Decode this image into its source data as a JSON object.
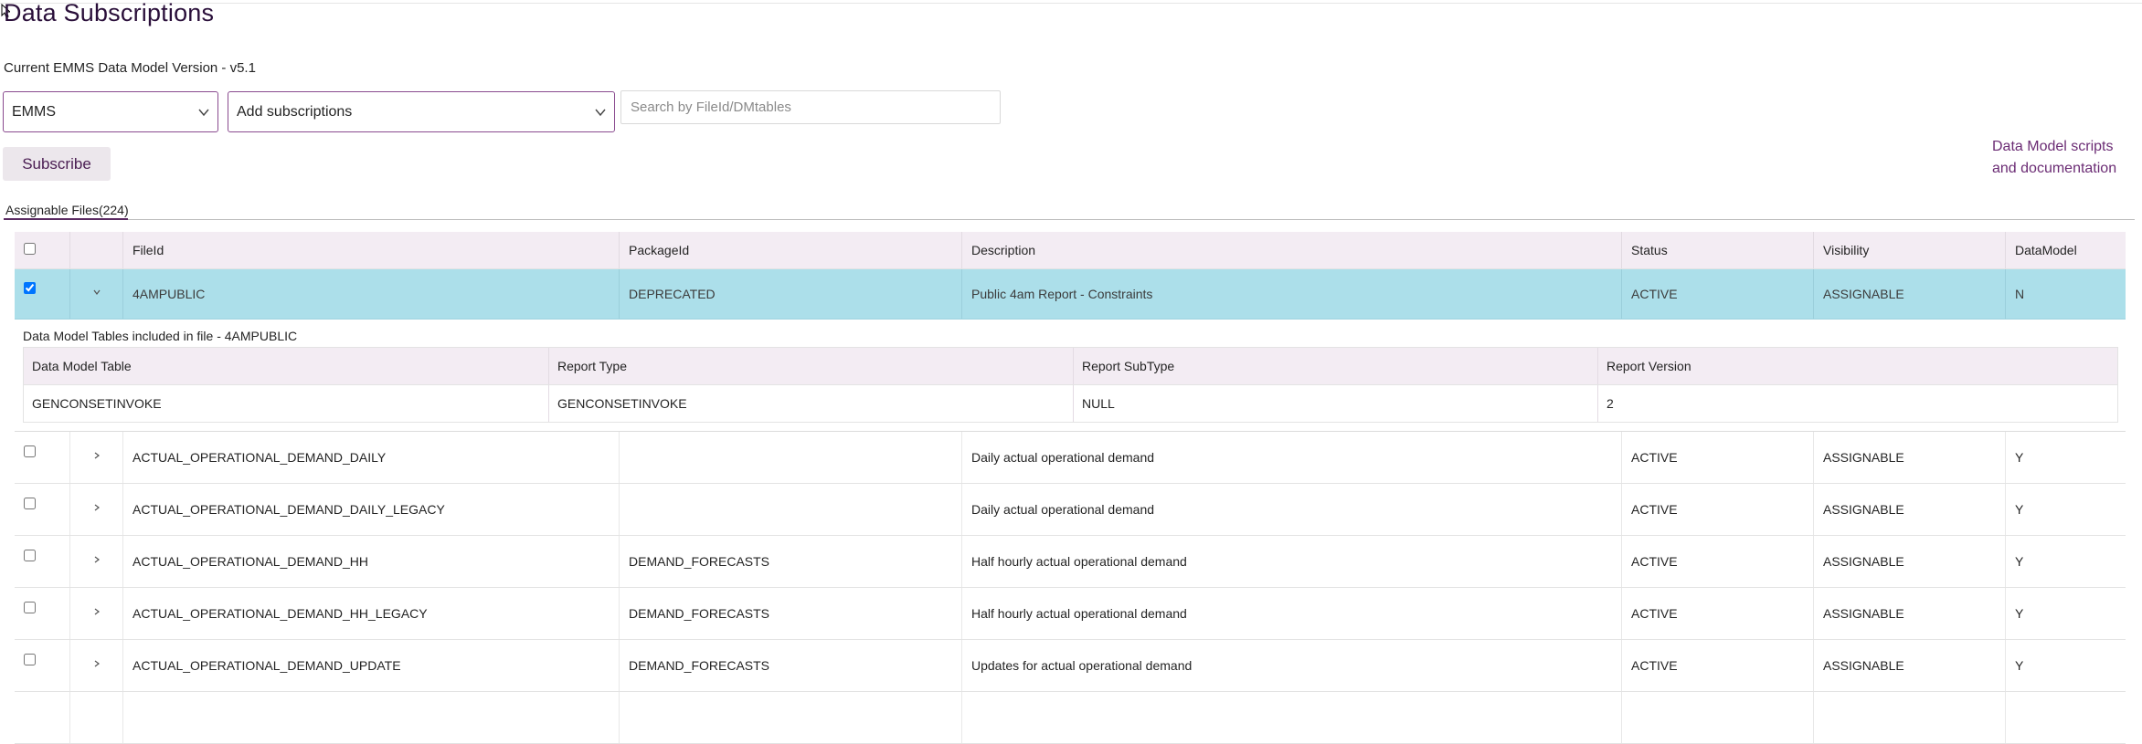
{
  "page": {
    "title": "Data Subscriptions",
    "model_version": "Current EMMS Data Model Version - v5.1"
  },
  "controls": {
    "system_select": {
      "value": "EMMS",
      "icon": "chevron-down-icon"
    },
    "subscription_select": {
      "value": "Add subscriptions",
      "icon": "chevron-down-icon"
    },
    "search": {
      "placeholder": "Search by FileId/DMtables"
    },
    "subscribe_label": "Subscribe",
    "doc_link_line1": "Data Model scripts",
    "doc_link_line2": "and documentation"
  },
  "tab": {
    "label": "Assignable Files(224)"
  },
  "columns": {
    "fileid": "FileId",
    "packageid": "PackageId",
    "description": "Description",
    "status": "Status",
    "visibility": "Visibility",
    "datamodel": "DataModel"
  },
  "rows": [
    {
      "fileid": "4AMPUBLIC",
      "packageid": "DEPRECATED",
      "description": "Public 4am Report - Constraints",
      "status": "ACTIVE",
      "visibility": "ASSIGNABLE",
      "datamodel": "N"
    },
    {
      "fileid": "ACTUAL_OPERATIONAL_DEMAND_DAILY",
      "packageid": "",
      "description": "Daily actual operational demand",
      "status": "ACTIVE",
      "visibility": "ASSIGNABLE",
      "datamodel": "Y"
    },
    {
      "fileid": "ACTUAL_OPERATIONAL_DEMAND_DAILY_LEGACY",
      "packageid": "",
      "description": "Daily actual operational demand",
      "status": "ACTIVE",
      "visibility": "ASSIGNABLE",
      "datamodel": "Y"
    },
    {
      "fileid": "ACTUAL_OPERATIONAL_DEMAND_HH",
      "packageid": "DEMAND_FORECASTS",
      "description": "Half hourly actual operational demand",
      "status": "ACTIVE",
      "visibility": "ASSIGNABLE",
      "datamodel": "Y"
    },
    {
      "fileid": "ACTUAL_OPERATIONAL_DEMAND_HH_LEGACY",
      "packageid": "DEMAND_FORECASTS",
      "description": "Half hourly actual operational demand",
      "status": "ACTIVE",
      "visibility": "ASSIGNABLE",
      "datamodel": "Y"
    },
    {
      "fileid": "ACTUAL_OPERATIONAL_DEMAND_UPDATE",
      "packageid": "DEMAND_FORECASTS",
      "description": "Updates for actual operational demand",
      "status": "ACTIVE",
      "visibility": "ASSIGNABLE",
      "datamodel": "Y"
    }
  ],
  "detail": {
    "caption": "Data Model Tables included in file - 4AMPUBLIC",
    "columns": {
      "table": "Data Model Table",
      "report_type": "Report Type",
      "report_subtype": "Report SubType",
      "report_version": "Report Version"
    },
    "rows": [
      {
        "table": "GENCONSETINVOKE",
        "report_type": "GENCONSETINVOKE",
        "report_subtype": "NULL",
        "report_version": "2"
      }
    ]
  }
}
